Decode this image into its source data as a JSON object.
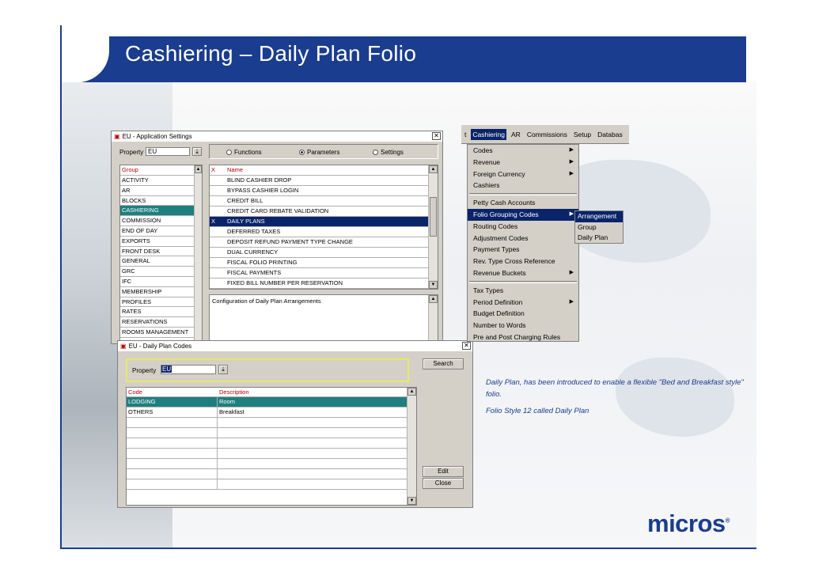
{
  "slide": {
    "title": "Cashiering – Daily Plan Folio"
  },
  "app_settings": {
    "window_title": "EU - Application Settings",
    "close": "✕",
    "property_label": "Property",
    "property_value": "EU",
    "radio_functions": "Functions",
    "radio_parameters": "Parameters",
    "radio_settings": "Settings",
    "group_header": "Group",
    "groups": [
      "ACTIVITY",
      "AR",
      "BLOCKS",
      "CASHIERING",
      "COMMISSION",
      "END OF DAY",
      "EXPORTS",
      "FRONT DESK",
      "GENERAL",
      "GRC",
      "IFC",
      "MEMBERSHIP",
      "PROFILES",
      "RATES",
      "RESERVATIONS",
      "ROOMS MANAGEMENT"
    ],
    "x_header": "X",
    "name_header": "Name",
    "params": [
      {
        "x": "",
        "name": "BLIND CASHIER DROP"
      },
      {
        "x": "",
        "name": "BYPASS CASHIER LOGIN"
      },
      {
        "x": "",
        "name": "CREDIT BILL"
      },
      {
        "x": "",
        "name": "CREDIT CARD REBATE VALIDATION"
      },
      {
        "x": "X",
        "name": "DAILY PLANS"
      },
      {
        "x": "",
        "name": "DEFERRED TAXES"
      },
      {
        "x": "",
        "name": "DEPOSIT REFUND PAYMENT TYPE CHANGE"
      },
      {
        "x": "",
        "name": "DUAL CURRENCY"
      },
      {
        "x": "",
        "name": "FISCAL FOLIO PRINTING"
      },
      {
        "x": "",
        "name": "FISCAL PAYMENTS"
      },
      {
        "x": "",
        "name": "FIXED BILL NUMBER PER RESERVATION"
      }
    ],
    "description": "Configuration of Daily Plan Arrangements"
  },
  "daily_plan_codes": {
    "window_title": "EU - Daily Plan Codes",
    "close": "✕",
    "property_label": "Property",
    "property_value": "EU",
    "search_label": "Search",
    "code_header": "Code",
    "desc_header": "Description",
    "rows": [
      {
        "code": "LODGING",
        "desc": "Room"
      },
      {
        "code": "OTHERS",
        "desc": "Breakfast"
      }
    ],
    "edit_label": "Edit",
    "close_label": "Close"
  },
  "menu": {
    "bar": [
      "t",
      "Cashiering",
      "AR",
      "Commissions",
      "Setup",
      "Databas"
    ],
    "items": [
      {
        "label": "Codes",
        "sub": true
      },
      {
        "label": "Revenue",
        "sub": true
      },
      {
        "label": "Foreign Currency",
        "sub": true
      },
      {
        "label": "Cashiers",
        "sub": false
      },
      {
        "sep": true
      },
      {
        "label": "Petty Cash Accounts",
        "sub": false
      },
      {
        "label": "Folio Grouping Codes",
        "sub": true
      },
      {
        "label": "Routing Codes",
        "sub": false
      },
      {
        "label": "Adjustment Codes",
        "sub": false
      },
      {
        "label": "Payment Types",
        "sub": false
      },
      {
        "label": "Rev. Type Cross Reference",
        "sub": false
      },
      {
        "label": "Revenue Buckets",
        "sub": true
      },
      {
        "sep": true
      },
      {
        "label": "Tax Types",
        "sub": false
      },
      {
        "label": "Period Definition",
        "sub": true
      },
      {
        "label": "Budget Definition",
        "sub": false
      },
      {
        "label": "Number to Words",
        "sub": false
      },
      {
        "label": "Pre and Post Charging Rules",
        "sub": false
      }
    ],
    "submenu": [
      "Arrangement",
      "Group",
      "Daily Plan"
    ]
  },
  "note": {
    "line1": "Daily Plan, has been introduced to enable a flexible \"Bed and Breakfast style\" folio.",
    "line2": "Folio Style 12 called Daily Plan"
  },
  "brand": {
    "name": "micros",
    "mark": "®"
  },
  "colors": {
    "accent": "#1a3d8f",
    "selection": "#1f7f7f",
    "highlight": "#0a246a"
  }
}
